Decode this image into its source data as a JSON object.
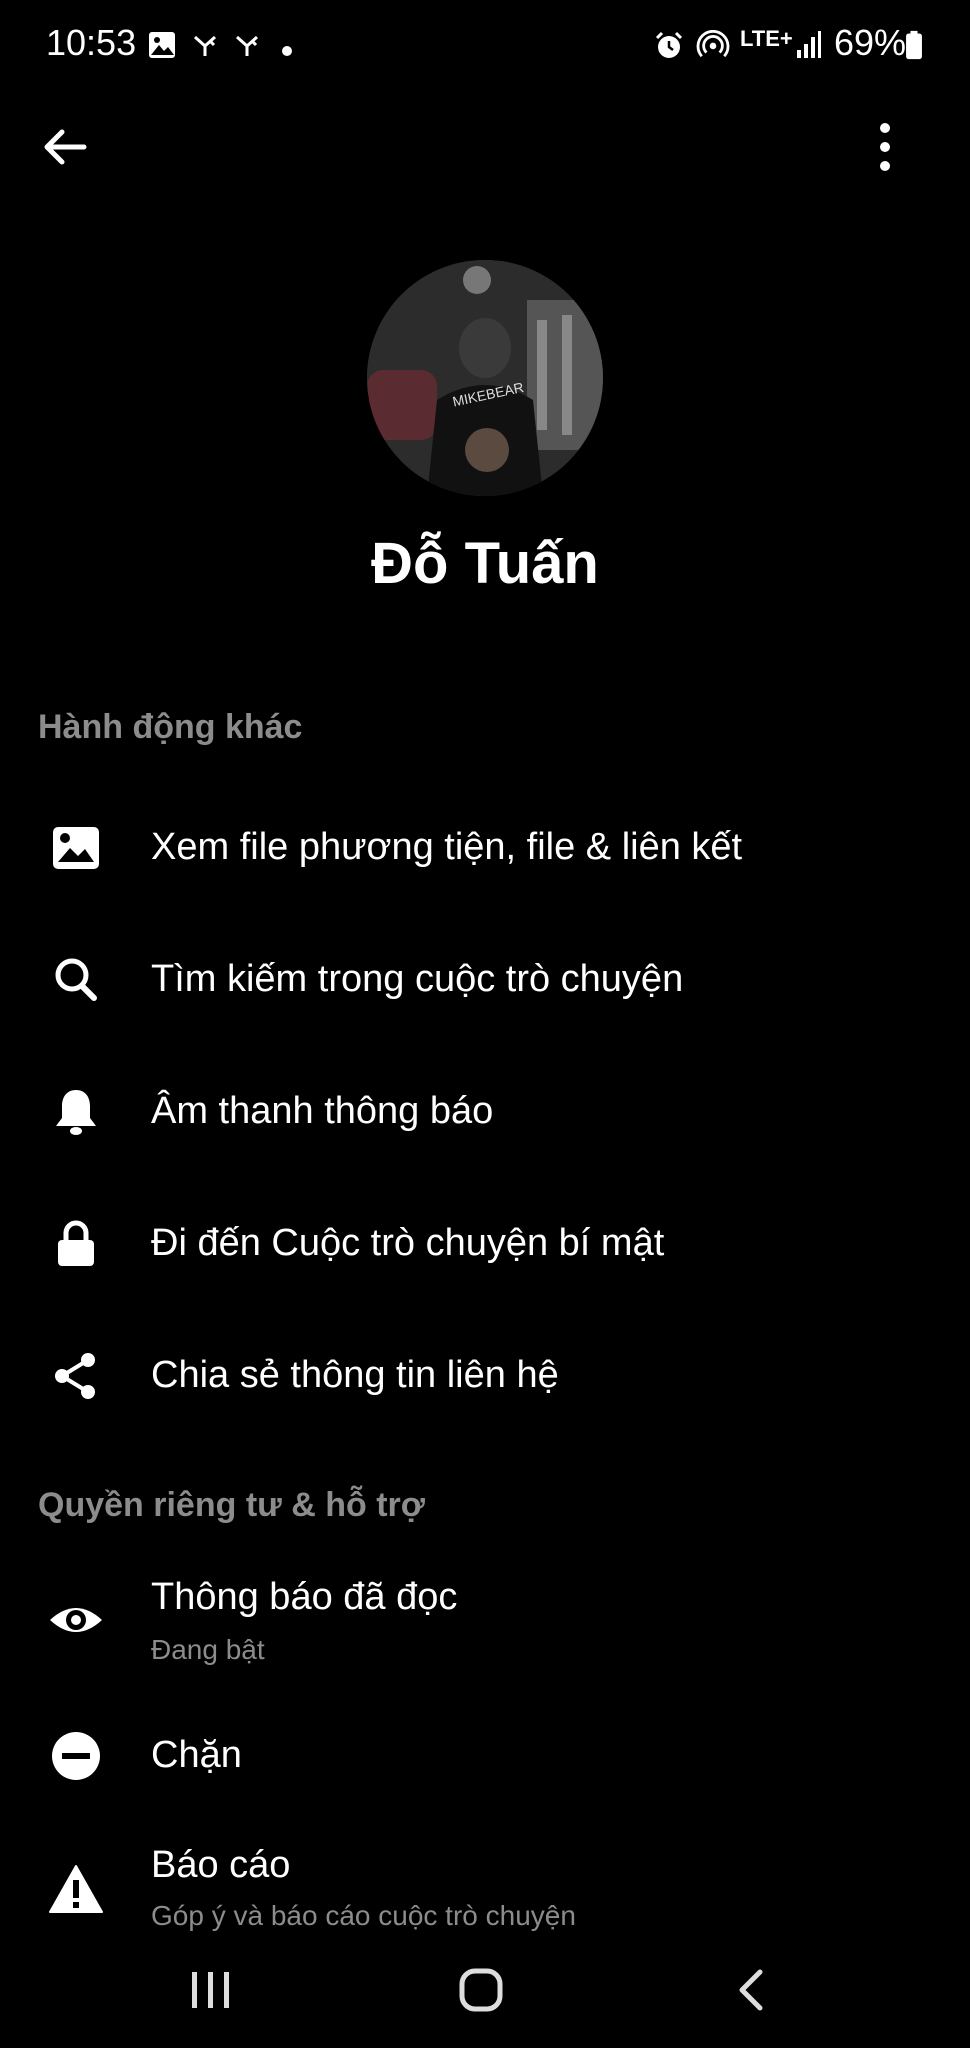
{
  "status_bar": {
    "time": "10:53",
    "network": "LTE+",
    "battery": "69%",
    "icons": [
      "image-icon",
      "signal-fork-icon",
      "signal-fork-icon",
      "dot-icon",
      "alarm-icon",
      "hotspot-icon",
      "lte-icon",
      "cell-signal-icon",
      "battery-icon"
    ]
  },
  "header": {
    "back_icon": "arrow-left-icon",
    "more_icon": "more-vertical-icon"
  },
  "profile": {
    "name": "Đỗ Tuấn",
    "avatar_text": "MIKEBEAR"
  },
  "sections": {
    "other_actions": {
      "title": "Hành động khác",
      "items": [
        {
          "label": "Xem file phương tiện, file & liên kết",
          "icon": "image-icon"
        },
        {
          "label": "Tìm kiếm trong cuộc trò chuyện",
          "icon": "search-icon"
        },
        {
          "label": "Âm thanh thông báo",
          "icon": "bell-icon"
        },
        {
          "label": "Đi đến Cuộc trò chuyện bí mật",
          "icon": "lock-icon"
        },
        {
          "label": "Chia sẻ thông tin liên hệ",
          "icon": "share-icon"
        }
      ]
    },
    "privacy": {
      "title": "Quyền riêng tư & hỗ trợ",
      "items": [
        {
          "label": "Thông báo đã đọc",
          "sub": "Đang bật",
          "icon": "eye-icon"
        },
        {
          "label": "Chặn",
          "icon": "block-icon"
        },
        {
          "label": "Báo cáo",
          "sub": "Góp ý và báo cáo cuộc trò chuyện",
          "icon": "warning-icon"
        }
      ]
    }
  },
  "nav": {
    "icons": [
      "recent-apps-icon",
      "home-icon",
      "back-icon"
    ]
  }
}
